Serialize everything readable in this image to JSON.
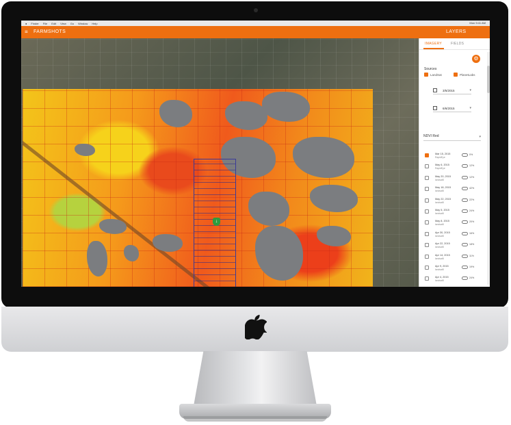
{
  "menubar": {
    "items": [
      "Finder",
      "File",
      "Edit",
      "View",
      "Go",
      "Window",
      "Help"
    ],
    "clock": "Mon 9:41 AM"
  },
  "app": {
    "brand": "FARMSHOTS",
    "layers_title": "LAYERS"
  },
  "panel": {
    "tabs": [
      {
        "label": "IMAGERY",
        "active": true
      },
      {
        "label": "FIELDS",
        "active": false
      }
    ],
    "sources_label": "Sources",
    "sources": [
      {
        "label": "LandSat",
        "checked": true
      },
      {
        "label": "PlanetLabs",
        "checked": true
      }
    ],
    "start_date": "3/5/2015",
    "end_date": "6/6/2015",
    "index_select": "NDVI Red",
    "images": [
      {
        "date": "Mar 15, 2015",
        "source": "RapidEye",
        "coverage": "0%",
        "checked": true
      },
      {
        "date": "May 6, 2015",
        "source": "RapidEye",
        "coverage": "12%",
        "checked": false
      },
      {
        "date": "May 20, 2015",
        "source": "landsat8",
        "coverage": "12%",
        "checked": false
      },
      {
        "date": "May 18, 2015",
        "source": "landsat8",
        "coverage": "42%",
        "checked": false
      },
      {
        "date": "May 22, 2015",
        "source": "landsat8",
        "coverage": "22%",
        "checked": false
      },
      {
        "date": "May 5, 2015",
        "source": "landsat8",
        "coverage": "24%",
        "checked": false
      },
      {
        "date": "May 8, 2015",
        "source": "landsat8",
        "coverage": "20%",
        "checked": false
      },
      {
        "date": "Apr 30, 2015",
        "source": "landsat8",
        "coverage": "16%",
        "checked": false
      },
      {
        "date": "Apr 22, 2015",
        "source": "landsat8",
        "coverage": "18%",
        "checked": false
      },
      {
        "date": "Apr 14, 2015",
        "source": "landsat8",
        "coverage": "11%",
        "checked": false
      },
      {
        "date": "Apr 9, 2015",
        "source": "landsat8",
        "coverage": "19%",
        "checked": false
      },
      {
        "date": "Apr 4, 2015",
        "source": "landsat8",
        "coverage": "24%",
        "checked": false
      },
      {
        "date": "Mar 30, 2015",
        "source": "landsat8",
        "coverage": "16%",
        "checked": false
      },
      {
        "date": "Mar 25, 2015",
        "source": "landsat8",
        "coverage": "16%",
        "checked": false
      }
    ]
  },
  "icons": {
    "menu": "hamburger-icon",
    "settings": "gear-icon",
    "calendar": "calendar-icon",
    "cloud": "cloud-icon",
    "pin": "field-marker-icon",
    "logo": "apple-logo"
  },
  "colors": {
    "accent": "#ee6f10",
    "ndvi_low": "#e9431c",
    "ndvi_mid": "#f5c51a",
    "ndvi_high": "#b6d23e",
    "cloud_mask": "#7b7d80"
  }
}
